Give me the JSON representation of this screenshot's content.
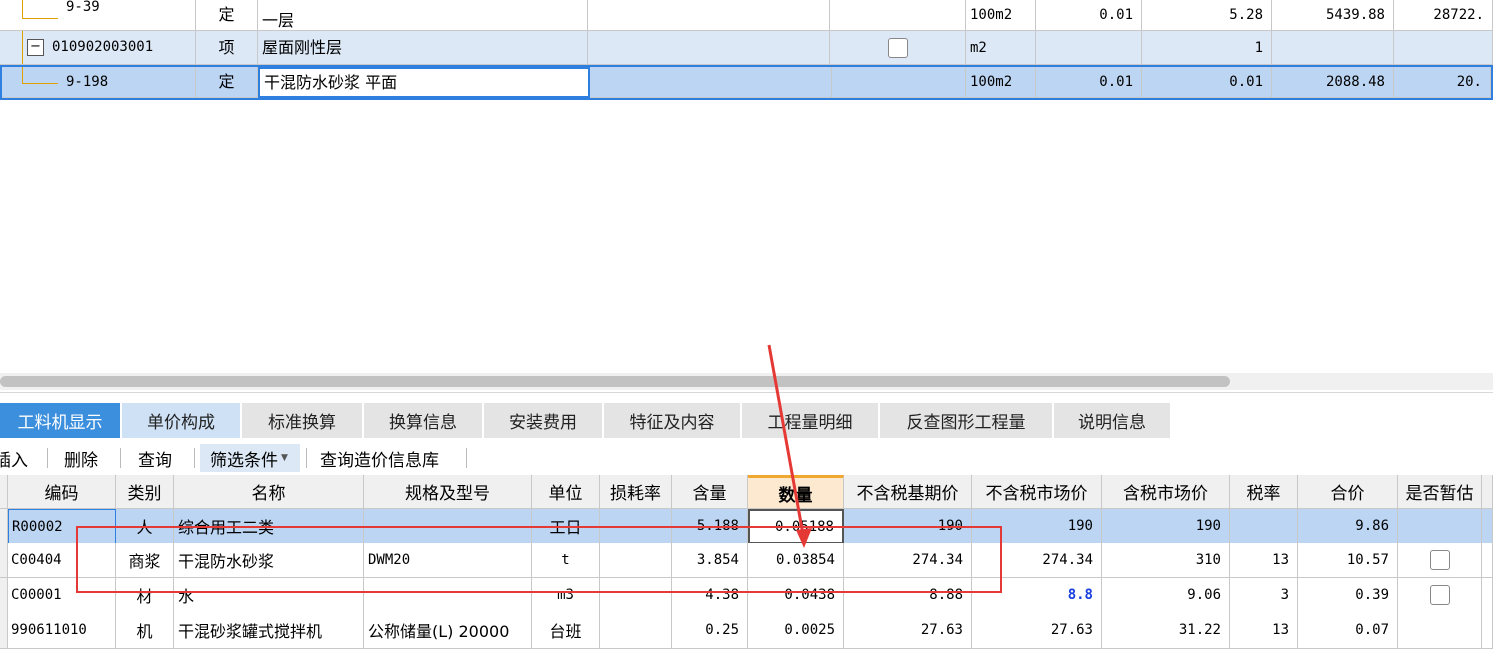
{
  "top_rows": [
    {
      "code": "9-39",
      "type": "定",
      "name": "一层",
      "unit": "100m2",
      "qty1": "0.01",
      "qty2": "5.28",
      "price": "5439.88",
      "total": "28722."
    },
    {
      "code": "010902003001",
      "type": "项",
      "name": "屋面刚性层",
      "unit": "m2",
      "qty1": "",
      "qty2": "1",
      "price": "",
      "total": ""
    },
    {
      "code": "9-198",
      "type": "定",
      "name": "干混防水砂浆 平面",
      "unit": "100m2",
      "qty1": "0.01",
      "qty2": "0.01",
      "price": "2088.48",
      "total": "20."
    }
  ],
  "tabs": [
    "工料机显示",
    "单价构成",
    "标准换算",
    "换算信息",
    "安装费用",
    "特征及内容",
    "工程量明细",
    "反查图形工程量",
    "说明信息"
  ],
  "toolbar": {
    "insert": "插入",
    "delete": "删除",
    "query": "查询",
    "filter": "筛选条件",
    "query_db": "查询造价信息库"
  },
  "columns": [
    "编码",
    "类别",
    "名称",
    "规格及型号",
    "单位",
    "损耗率",
    "含量",
    "数量",
    "不含税基期价",
    "不含税市场价",
    "含税市场价",
    "税率",
    "合价",
    "是否暂估"
  ],
  "rows": [
    {
      "code": "R00002",
      "type": "人",
      "name": "综合用工二类",
      "spec": "",
      "unit": "工日",
      "loss": "",
      "content": "5.188",
      "qty": "0.05188",
      "base": "190",
      "market": "190",
      "tax_market": "190",
      "rate": "",
      "total": "9.86",
      "est": false
    },
    {
      "code": "C00404",
      "type": "商浆",
      "name": "干混防水砂浆",
      "spec": "DWM20",
      "unit": "t",
      "loss": "",
      "content": "3.854",
      "qty": "0.03854",
      "base": "274.34",
      "market": "274.34",
      "tax_market": "310",
      "rate": "13",
      "total": "10.57",
      "est": true
    },
    {
      "code": "C00001",
      "type": "材",
      "name": "水",
      "spec": "",
      "unit": "m3",
      "loss": "",
      "content": "4.38",
      "qty": "0.0438",
      "base": "8.88",
      "market": "8.8",
      "tax_market": "9.06",
      "rate": "3",
      "total": "0.39",
      "est": true
    },
    {
      "code": "990611010",
      "type": "机",
      "name": "干混砂浆罐式搅拌机",
      "spec": "公称储量(L) 20000",
      "unit": "台班",
      "loss": "",
      "content": "0.25",
      "qty": "0.0025",
      "base": "27.63",
      "market": "27.63",
      "tax_market": "31.22",
      "rate": "13",
      "total": "0.07",
      "est": null
    }
  ],
  "colors": {
    "selected_row": "#bcd5f3",
    "tab_active": "#3c8fdd",
    "tab_second": "#cfe1f5",
    "annotation": "#e53935",
    "highlight_value": "#1a3fe0"
  }
}
